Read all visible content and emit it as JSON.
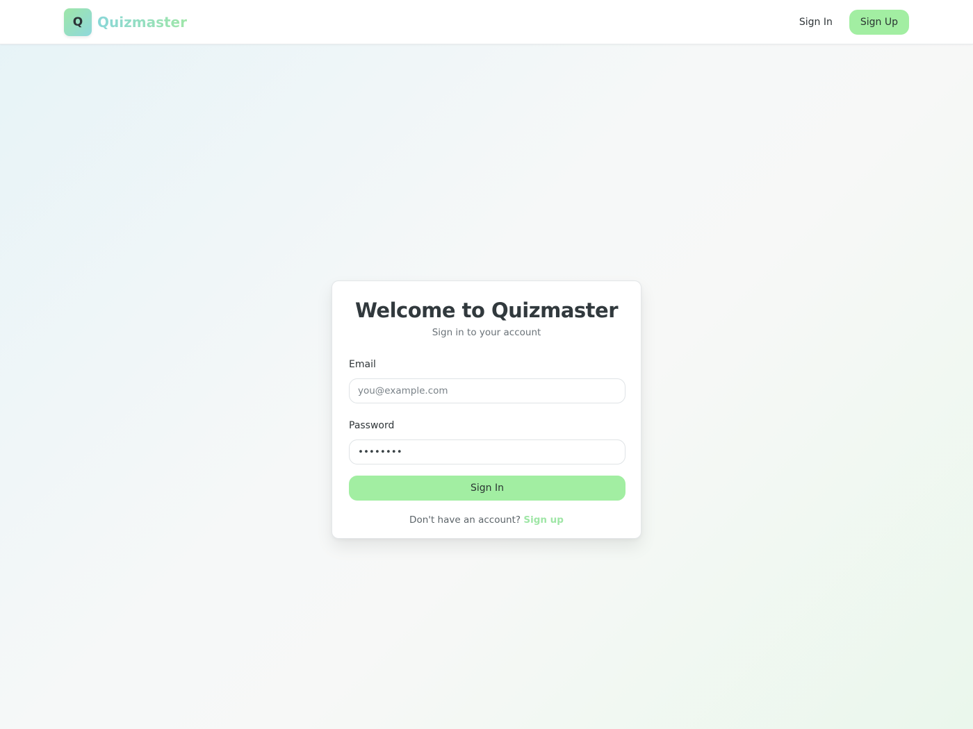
{
  "header": {
    "logo_letter": "Q",
    "brand_name": "Quizmaster",
    "signin_label": "Sign In",
    "signup_label": "Sign Up"
  },
  "login": {
    "title": "Welcome to Quizmaster",
    "subtitle": "Sign in to your account",
    "email_label": "Email",
    "email_placeholder": "you@example.com",
    "email_value": "",
    "password_label": "Password",
    "password_value": "••••••••",
    "submit_label": "Sign In",
    "footer_text": "Don't have an account?",
    "footer_link": "Sign up"
  },
  "colors": {
    "accent_green": "#a2eea2",
    "brand_teal": "#8ad7d8",
    "text_dark": "#31393d"
  }
}
